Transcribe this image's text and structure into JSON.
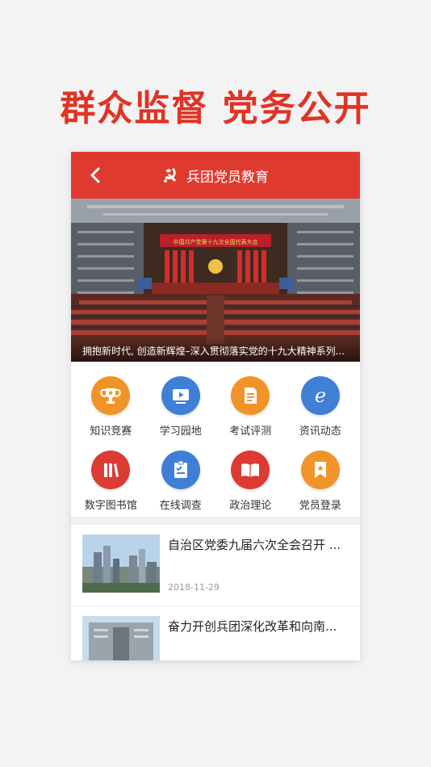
{
  "headline": "群众监督  党务公开",
  "app": {
    "title": "兵团党员教育",
    "back_icon": "chevron-left-icon",
    "logo_icon": "party-emblem-icon",
    "bar_color": "#df3a2e"
  },
  "banner": {
    "caption": "拥抱新时代, 创造新辉煌–深入贯彻落实党的十九大精神系列...",
    "screen_text": "中国共产党第十九次全国代表大会"
  },
  "menu": [
    {
      "label": "知识竞赛",
      "icon": "trophy-icon",
      "color": "#f0942a"
    },
    {
      "label": "学习园地",
      "icon": "video-icon",
      "color": "#3f7fd6"
    },
    {
      "label": "考试评测",
      "icon": "document-icon",
      "color": "#f0942a"
    },
    {
      "label": "资讯动态",
      "icon": "browser-e-icon",
      "color": "#3f7fd6"
    },
    {
      "label": "数字图书馆",
      "icon": "books-icon",
      "color": "#dc3a32"
    },
    {
      "label": "在线调查",
      "icon": "survey-icon",
      "color": "#3f7fd6"
    },
    {
      "label": "政治理论",
      "icon": "open-book-icon",
      "color": "#dc3a32"
    },
    {
      "label": "党员登录",
      "icon": "bookmark-icon",
      "color": "#f0942a"
    }
  ],
  "news": [
    {
      "title": "自治区党委九届六次全会召开 ...",
      "date": "2018-11-29"
    },
    {
      "title": "奋力开创兵团深化改革和向南...",
      "date": ""
    }
  ]
}
